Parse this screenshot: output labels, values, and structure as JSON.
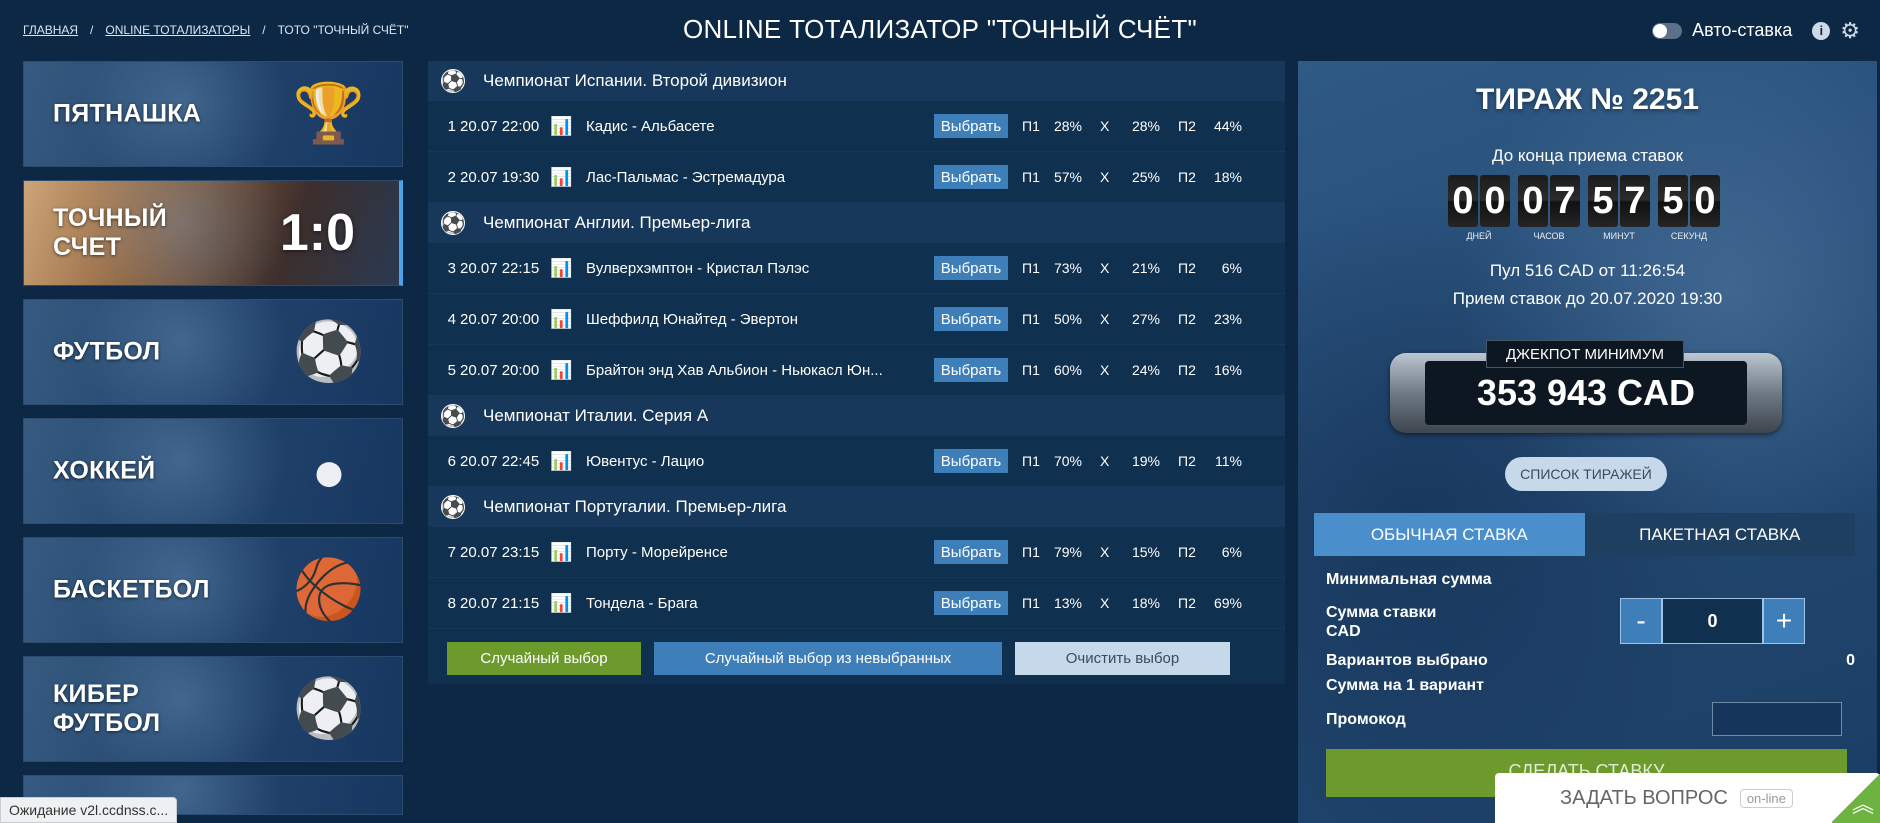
{
  "breadcrumb": {
    "home": "ГЛАВНАЯ",
    "section": "ONLINE ТОТАЛИЗАТОРЫ",
    "current": "ТОТО \"ТОЧНЫЙ СЧЁТ\""
  },
  "page_title": "ONLINE ТОТАЛИЗАТОР \"ТОЧНЫЙ СЧЁТ\"",
  "auto_bet_label": "Авто-ставка",
  "info_icon_glyph": "i",
  "gear_icon_glyph": "⚙",
  "games": [
    {
      "label": "ПЯТНАШКА",
      "icon": "trophy-icon",
      "glyph": "🏆"
    },
    {
      "label": "ТОЧНЫЙ\nСЧЕТ",
      "score": "1:0",
      "active": true
    },
    {
      "label": "ФУТБОЛ",
      "icon": "soccer-ball-icon",
      "glyph": "⚽"
    },
    {
      "label": "ХОККЕЙ",
      "icon": "hockey-puck-icon",
      "glyph": "●"
    },
    {
      "label": "БАСКЕТБОЛ",
      "icon": "basketball-icon",
      "glyph": "🏀"
    },
    {
      "label": "КИБЕР\nФУТБОЛ",
      "icon": "cyber-ball-icon",
      "glyph": "⚽"
    }
  ],
  "leagues": [
    {
      "name": "Чемпионат Испании. Второй дивизион",
      "matches": [
        {
          "num": "1",
          "date": "20.07 22:00",
          "teams": "Кадис - Альбасете",
          "p1": "28%",
          "x": "28%",
          "p2": "44%"
        },
        {
          "num": "2",
          "date": "20.07 19:30",
          "teams": "Лас-Пальмас - Эстремадура",
          "p1": "57%",
          "x": "25%",
          "p2": "18%"
        }
      ]
    },
    {
      "name": "Чемпионат Англии. Премьер-лига",
      "matches": [
        {
          "num": "3",
          "date": "20.07 22:15",
          "teams": "Вулверхэмптон - Кристал Пэлэс",
          "p1": "73%",
          "x": "21%",
          "p2": "6%"
        },
        {
          "num": "4",
          "date": "20.07 20:00",
          "teams": "Шеффилд Юнайтед - Эвертон",
          "p1": "50%",
          "x": "27%",
          "p2": "23%"
        },
        {
          "num": "5",
          "date": "20.07 20:00",
          "teams": "Брайтон энд Хав Альбион - Ньюкасл Юн...",
          "p1": "60%",
          "x": "24%",
          "p2": "16%"
        }
      ]
    },
    {
      "name": "Чемпионат Италии. Серия А",
      "matches": [
        {
          "num": "6",
          "date": "20.07 22:45",
          "teams": "Ювентус - Лацио",
          "p1": "70%",
          "x": "19%",
          "p2": "11%"
        }
      ]
    },
    {
      "name": "Чемпионат Португалии. Премьер-лига",
      "matches": [
        {
          "num": "7",
          "date": "20.07 23:15",
          "teams": "Порту - Морейренсе",
          "p1": "79%",
          "x": "15%",
          "p2": "6%"
        },
        {
          "num": "8",
          "date": "20.07 21:15",
          "teams": "Тондела - Брага",
          "p1": "13%",
          "x": "18%",
          "p2": "69%"
        }
      ]
    }
  ],
  "labels": {
    "select": "Выбрать",
    "p1": "П1",
    "x": "Х",
    "p2": "П2"
  },
  "actions": {
    "random": "Случайный выбор",
    "random_unselected": "Случайный выбор из невыбранных",
    "clear": "Очистить выбор"
  },
  "draw": {
    "title": "ТИРАЖ № 2251",
    "until": "До конца приема ставок",
    "timer": [
      {
        "digits": [
          "0",
          "0"
        ],
        "label": "ДНЕЙ"
      },
      {
        "digits": [
          "0",
          "7"
        ],
        "label": "ЧАСОВ"
      },
      {
        "digits": [
          "5",
          "7"
        ],
        "label": "МИНУТ"
      },
      {
        "digits": [
          "5",
          "0"
        ],
        "label": "СЕКУНД"
      }
    ],
    "pool": "Пул 516 CAD от 11:26:54",
    "accept": "Прием ставок до 20.07.2020 19:30",
    "jackpot_label": "ДЖЕКПОТ МИНИМУМ",
    "jackpot_value": "353 943 CAD",
    "list_button": "СПИСОК ТИРАЖЕЙ"
  },
  "bet": {
    "tab_normal": "ОБЫЧНАЯ СТАВКА",
    "tab_package": "ПАКЕТНАЯ СТАВКА",
    "min_sum": "Минимальная сумма",
    "bet_sum": "Сумма ставки\nCAD",
    "minus": "-",
    "plus": "+",
    "amount": "0",
    "variants": "Вариантов выбрано",
    "variants_value": "0",
    "per_variant": "Сумма на 1 вариант",
    "promo": "Промокод",
    "make_bet": "СДЕЛАТЬ СТАВКУ"
  },
  "ask": {
    "label": "ЗАДАТЬ ВОПРОС",
    "status": "on-line",
    "chevron": "︽"
  },
  "status_bar": "Ожидание v2l.ccdnss.c..."
}
